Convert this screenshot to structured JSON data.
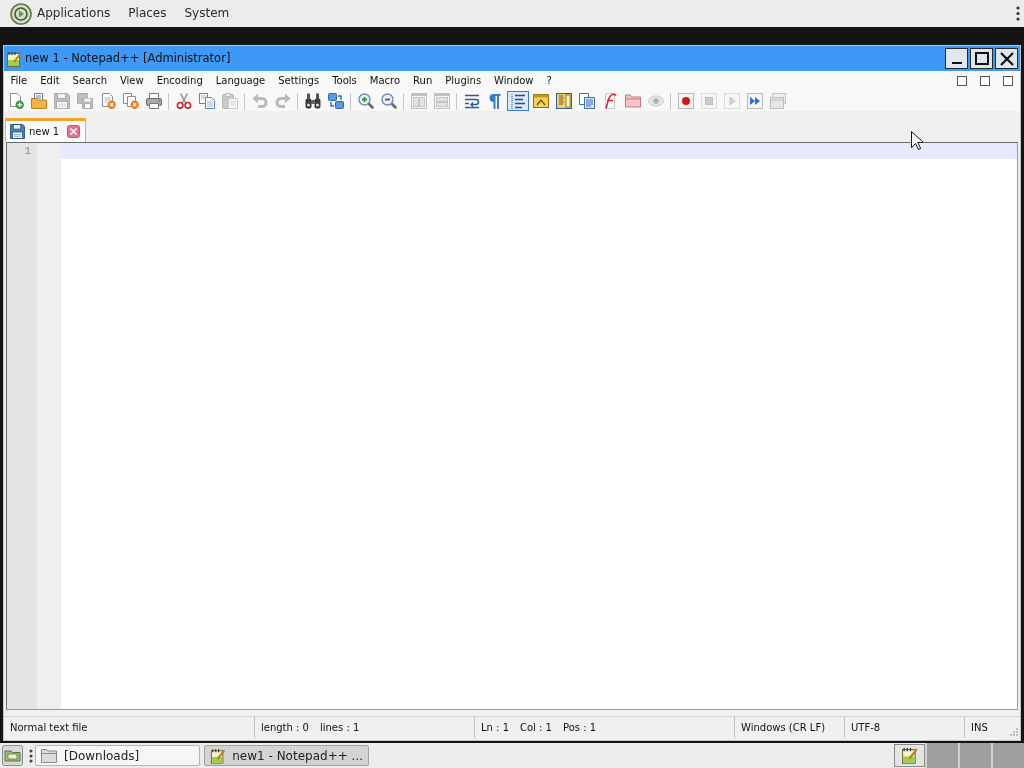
{
  "top_panel": {
    "menus": [
      "Applications",
      "Places",
      "System"
    ]
  },
  "window": {
    "title": "new 1 - Notepad++ [Administrator]"
  },
  "menu_bar": [
    "File",
    "Edit",
    "Search",
    "View",
    "Encoding",
    "Language",
    "Settings",
    "Tools",
    "Macro",
    "Run",
    "Plugins",
    "Window",
    "?"
  ],
  "toolbar": [
    {
      "kind": "new",
      "disabled": false,
      "pressed": false
    },
    {
      "kind": "open",
      "disabled": false,
      "pressed": false
    },
    {
      "kind": "save",
      "disabled": true,
      "pressed": false
    },
    {
      "kind": "save_all",
      "disabled": true,
      "pressed": false
    },
    {
      "kind": "close",
      "disabled": false,
      "pressed": false
    },
    {
      "kind": "close_all",
      "disabled": false,
      "pressed": false
    },
    {
      "kind": "print",
      "disabled": false,
      "pressed": false
    },
    {
      "kind": "separator"
    },
    {
      "kind": "cut",
      "disabled": false,
      "pressed": false
    },
    {
      "kind": "copy",
      "disabled": false,
      "pressed": false
    },
    {
      "kind": "paste",
      "disabled": true,
      "pressed": false
    },
    {
      "kind": "separator"
    },
    {
      "kind": "undo",
      "disabled": true,
      "pressed": false
    },
    {
      "kind": "redo",
      "disabled": true,
      "pressed": false
    },
    {
      "kind": "separator"
    },
    {
      "kind": "find",
      "disabled": false,
      "pressed": false
    },
    {
      "kind": "replace",
      "disabled": false,
      "pressed": false
    },
    {
      "kind": "separator"
    },
    {
      "kind": "zoom_in",
      "disabled": false,
      "pressed": false
    },
    {
      "kind": "zoom_out",
      "disabled": false,
      "pressed": false
    },
    {
      "kind": "separator"
    },
    {
      "kind": "sync_vertical",
      "disabled": true,
      "pressed": false
    },
    {
      "kind": "sync_horizontal",
      "disabled": true,
      "pressed": false
    },
    {
      "kind": "separator"
    },
    {
      "kind": "wrap",
      "disabled": false,
      "pressed": false
    },
    {
      "kind": "show_all",
      "disabled": false,
      "pressed": false
    },
    {
      "kind": "indent_guide",
      "disabled": false,
      "pressed": true
    },
    {
      "kind": "user_language",
      "disabled": false,
      "pressed": false
    },
    {
      "kind": "doc_map",
      "disabled": false,
      "pressed": false
    },
    {
      "kind": "doc_list",
      "disabled": false,
      "pressed": false
    },
    {
      "kind": "function_list",
      "disabled": false,
      "pressed": false
    },
    {
      "kind": "folder_workspace",
      "disabled": false,
      "pressed": false
    },
    {
      "kind": "monitoring",
      "disabled": true,
      "pressed": false
    },
    {
      "kind": "separator"
    },
    {
      "kind": "record",
      "disabled": false,
      "pressed": false
    },
    {
      "kind": "stop",
      "disabled": true,
      "pressed": false
    },
    {
      "kind": "play",
      "disabled": true,
      "pressed": false
    },
    {
      "kind": "play_multiple",
      "disabled": false,
      "pressed": false
    },
    {
      "kind": "save_macro",
      "disabled": true,
      "pressed": false
    }
  ],
  "tabs": [
    {
      "label": "new 1",
      "selected": true
    }
  ],
  "editor": {
    "lines": [
      {
        "number": "1",
        "current": true
      }
    ]
  },
  "status_bar": [
    [
      "Normal text file"
    ],
    [
      "length : 0",
      "lines : 1"
    ],
    [
      "Ln : 1",
      "Col : 1",
      "Pos : 1"
    ],
    [
      "Windows (CR LF)"
    ],
    [
      "UTF-8"
    ],
    [
      "INS"
    ]
  ],
  "taskbar": {
    "buttons": [
      {
        "kind": "folder",
        "label": "[Downloads]",
        "selected": false
      },
      {
        "kind": "notepad",
        "label": "new1 - Notepad++ ...",
        "selected": true
      }
    ]
  }
}
